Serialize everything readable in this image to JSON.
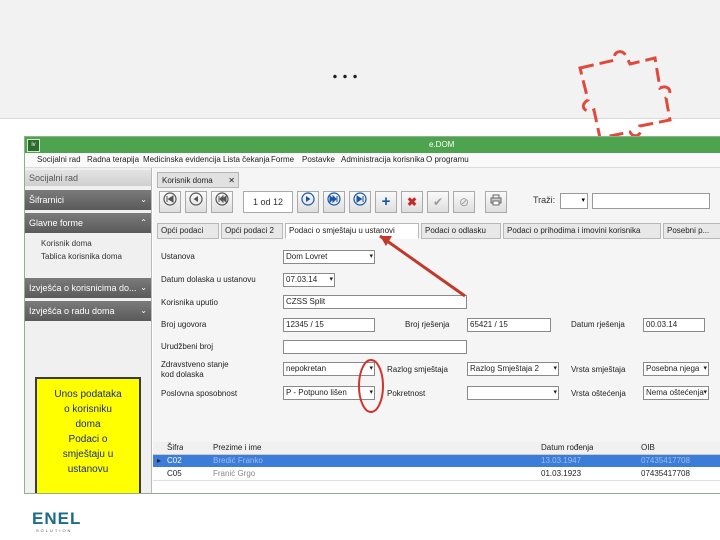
{
  "slide": {
    "title": "…",
    "puzzle_icon": "puzzle-piece-outline"
  },
  "app": {
    "window_title": "e.DOM",
    "window_icon_label": "iv",
    "menu": [
      "Socijalni rad",
      "Radna terapija",
      "Medicinska evidencija",
      "Lista čekanja",
      "Forme",
      "Postavke",
      "Administracija korisnika",
      "O programu"
    ],
    "sidebar": {
      "header": "Socijalni rad",
      "sections": [
        {
          "label": "Šifrarnici",
          "chev": "⌄"
        },
        {
          "label": "Glavne forme",
          "chev": "⌃"
        },
        {
          "label": "Izvješća o korisnicima do...",
          "chev": "⌄"
        },
        {
          "label": "Izvješća o radu doma",
          "chev": "⌄"
        }
      ],
      "items": [
        "Korisnik doma",
        "Tablica korisnika doma"
      ]
    },
    "callout": {
      "lines": [
        "Unos podataka",
        "o korisniku",
        "doma",
        "Podaci o",
        "smještaju u",
        "ustanovu"
      ]
    },
    "doc_tab": {
      "label": "Korisnik doma",
      "close": "✕"
    },
    "toolbar": {
      "counter": "1 od 12",
      "buttons": [
        "first-icon",
        "prev-icon",
        "next-icon",
        "last-icon",
        "add-icon",
        "delete-icon",
        "confirm-icon",
        "cancel-icon",
        "print-icon"
      ],
      "search_label": "Traži:"
    },
    "tabs": [
      "Opći podaci",
      "Opći podaci 2",
      "Podaci o smještaju u ustanovi",
      "Podaci o odlasku",
      "Podaci o prihodima i imovini korisnika",
      "Posebni p..."
    ],
    "form": {
      "ustanova_label": "Ustanova",
      "ustanova_value": "Dom Lovret",
      "datum_dolaska_label": "Datum dolaska u ustanovu",
      "datum_dolaska_value": "07.03.14",
      "korisnika_uputio_label": "Korisnika uputio",
      "korisnika_uputio_value": "CZSS Split",
      "broj_ugovora_label": "Broj ugovora",
      "broj_ugovora_value": "12345 / 15",
      "broj_rjesenja_label": "Broj rješenja",
      "broj_rjesenja_value": "65421 / 15",
      "datum_rjesenja_label": "Datum rješenja",
      "datum_rjesenja_value": "00.03.14",
      "urudzbeni_broj_label": "Urudžbeni broj",
      "zdravstveno_label_1": "Zdravstveno stanje",
      "zdravstveno_label_2": "kod dolaska",
      "zdravstveno_value": "nepokretan",
      "razlog_label": "Razlog smještaja",
      "razlog_value": "Razlog Smještaja 2",
      "vrsta_smjestaja_label": "Vrsta smještaja",
      "vrsta_smjestaja_value": "Posebna njega",
      "poslovna_label": "Poslovna sposobnost",
      "poslovna_value": "P - Potpuno lišen",
      "pokretnost_label": "Pokretnost",
      "vrsta_ostecenja_label": "Vrsta oštećenja",
      "vrsta_ostecenja_value": "Nema oštećenja"
    },
    "grid": {
      "columns": [
        "Šifra",
        "Prezime i ime",
        "Datum rođenja",
        "OIB"
      ],
      "rows": [
        {
          "marker": "▸",
          "sifra": "C02",
          "ime": "Bredić Franko",
          "datum": "13.03.1947",
          "oib": "07435417708"
        },
        {
          "marker": "",
          "sifra": "C05",
          "ime": "Franić Grgo",
          "datum": "01.03.1923",
          "oib": "07435417708"
        }
      ]
    }
  },
  "logo": {
    "text": "ENEL",
    "sub": "SOLUTION"
  },
  "colors": {
    "titlebar": "#4ea44e",
    "callout": "#ffff00",
    "callout_text": "#1b2a80",
    "arrow": "#c0392b",
    "selected_row": "#3b7dd8"
  }
}
